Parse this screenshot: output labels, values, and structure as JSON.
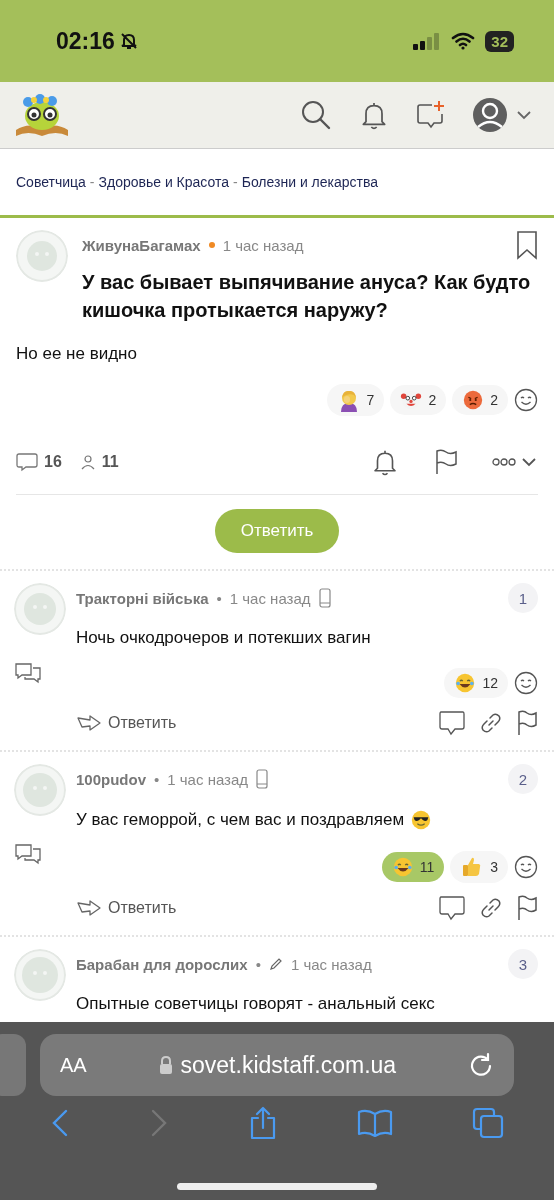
{
  "status_bar": {
    "time": "02:16",
    "battery": "32"
  },
  "breadcrumb": [
    {
      "label": "Советчица"
    },
    {
      "label": "Здоровье и Красота"
    },
    {
      "label": "Болезни и лекарства"
    }
  ],
  "breadcrumb_separator": "-",
  "post": {
    "author": "ЖивунаБагамах",
    "online": true,
    "time": "1 час назад",
    "title": "У вас бывает выпячивание ануса? Как будто кишочка протыкается наружу?",
    "body": "Но ее не видно",
    "reactions": [
      {
        "kind": "facepalm",
        "count": "7",
        "selected": false
      },
      {
        "kind": "clown",
        "count": "2",
        "selected": false
      },
      {
        "kind": "angry",
        "count": "2",
        "selected": false
      }
    ],
    "comments_count": "16",
    "participants_count": "11"
  },
  "reply_button": "Ответить",
  "comments": [
    {
      "author": "Тракторні війська",
      "separator": "•",
      "edited": false,
      "time": "1 час назад",
      "mobile": true,
      "number": "1",
      "text": "Ночь очкодрочеров и потекших вагин",
      "text_emoji": false,
      "reactions": [
        {
          "kind": "laugh",
          "count": "12",
          "selected": false
        }
      ],
      "reply": "Ответить"
    },
    {
      "author": "100pudov",
      "separator": "•",
      "edited": false,
      "time": "1 час назад",
      "mobile": true,
      "number": "2",
      "text": "У вас геморрой, с чем вас и поздравляем",
      "text_emoji": true,
      "reactions": [
        {
          "kind": "laugh",
          "count": "11",
          "selected": true
        },
        {
          "kind": "thumbs",
          "count": "3",
          "selected": false
        }
      ],
      "reply": "Ответить"
    },
    {
      "author": "Барабан для дорослих",
      "separator": "•",
      "edited": true,
      "time": "1 час назад",
      "mobile": false,
      "number": "3",
      "text": "Опытные советчицы говорят - анальный секс",
      "text_emoji": false
    }
  ],
  "browser": {
    "text_size": "AA",
    "url": "sovet.kidstaff.com.ua"
  }
}
